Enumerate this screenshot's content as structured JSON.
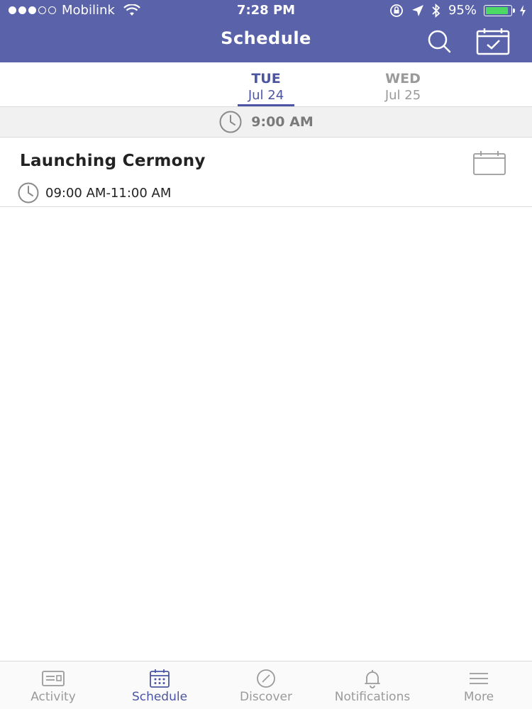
{
  "status_bar": {
    "carrier": "Mobilink",
    "time": "7:28 PM",
    "battery_percent": "95%",
    "battery_level": 0.95,
    "signal_filled": 3,
    "signal_total": 5
  },
  "header": {
    "title": "Schedule",
    "search_icon": "search-icon",
    "calendar_icon": "calendar-check-icon",
    "background_color": "#5a63a9"
  },
  "days": [
    {
      "dow": "TUE",
      "date": "Jul 24",
      "active": true
    },
    {
      "dow": "WED",
      "date": "Jul 25",
      "active": false
    }
  ],
  "time_section": {
    "label": "9:00 AM",
    "icon": "clock-icon"
  },
  "events": [
    {
      "title": "Launching Cermony",
      "time": "09:00 AM-11:00 AM",
      "icon": "calendar-icon"
    }
  ],
  "tabbar": {
    "items": [
      {
        "label": "Activity",
        "icon": "activity-icon",
        "active": false
      },
      {
        "label": "Schedule",
        "icon": "calendar-grid-icon",
        "active": true
      },
      {
        "label": "Discover",
        "icon": "compass-icon",
        "active": false
      },
      {
        "label": "Notifications",
        "icon": "bell-icon",
        "active": false
      },
      {
        "label": "More",
        "icon": "menu-icon",
        "active": false
      }
    ],
    "accent_color": "#4b55a3",
    "inactive_color": "#9a9a9a"
  }
}
